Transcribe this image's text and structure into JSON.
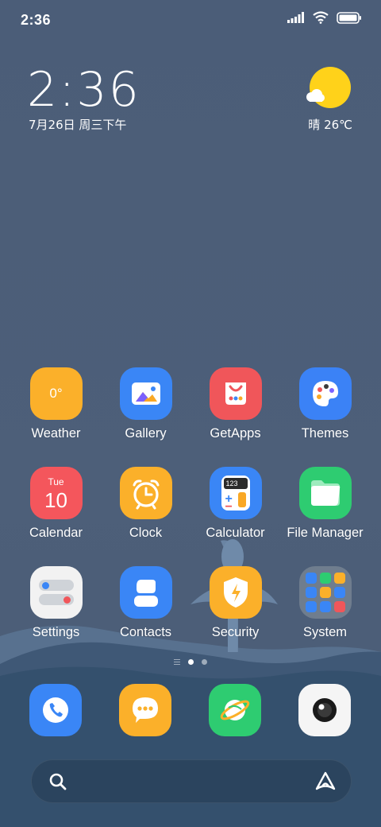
{
  "status_bar": {
    "time": "2:36"
  },
  "clock_widget": {
    "time": "2:36",
    "date": "7月26日 周三下午"
  },
  "weather_widget": {
    "text": "晴 26℃"
  },
  "apps": [
    {
      "label": "Weather",
      "icon": "weather-icon",
      "color": "#fbb02a",
      "badge": "0°"
    },
    {
      "label": "Gallery",
      "icon": "gallery-icon",
      "color": "#3a86f6"
    },
    {
      "label": "GetApps",
      "icon": "getapps-icon",
      "color": "#f0565a"
    },
    {
      "label": "Themes",
      "icon": "themes-icon",
      "color": "#3b82f6"
    },
    {
      "label": "Calendar",
      "icon": "calendar-icon",
      "color": "#f4565c",
      "day": "Tue",
      "date": "10"
    },
    {
      "label": "Clock",
      "icon": "clock-icon",
      "color": "#fbb02a"
    },
    {
      "label": "Calculator",
      "icon": "calculator-icon",
      "color": "#3a86f6",
      "screen": "123"
    },
    {
      "label": "File Manager",
      "icon": "folder-icon",
      "color": "#2ecc71"
    },
    {
      "label": "Settings",
      "icon": "settings-icon",
      "color": "#f2f2f2"
    },
    {
      "label": "Contacts",
      "icon": "contacts-icon",
      "color": "#3a86f6"
    },
    {
      "label": "Security",
      "icon": "security-icon",
      "color": "#fbb02a"
    },
    {
      "label": "System",
      "icon": "folder-grid-icon",
      "color": "#6f7d8e"
    }
  ],
  "dock": [
    {
      "icon": "phone-icon",
      "color": "#3a86f6"
    },
    {
      "icon": "messages-icon",
      "color": "#fbb02a"
    },
    {
      "icon": "browser-icon",
      "color": "#2ecc71"
    },
    {
      "icon": "camera-icon",
      "color": "#f5f5f5"
    }
  ],
  "search": {
    "placeholder": ""
  }
}
